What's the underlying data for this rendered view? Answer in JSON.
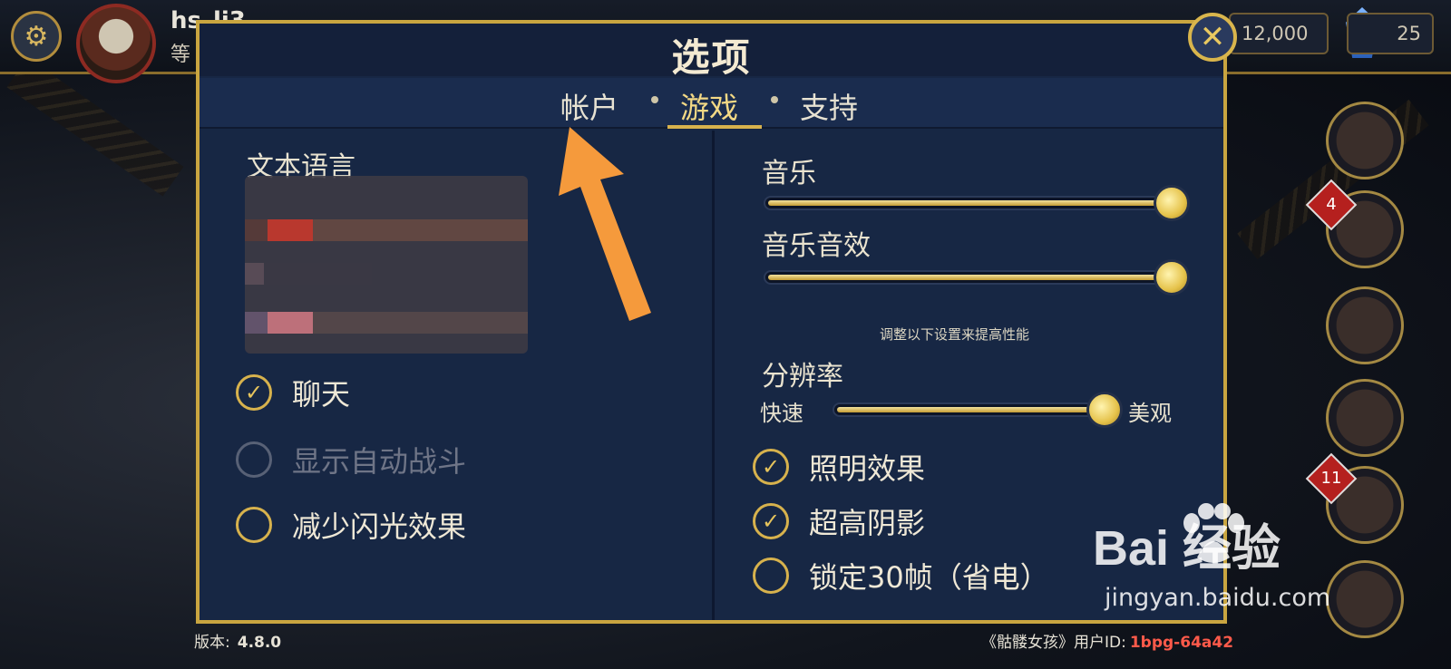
{
  "hud": {
    "username": "hs_li3",
    "level_prefix": "等",
    "coins": "12,000",
    "gems": "25"
  },
  "side_badges": [
    "4",
    "11"
  ],
  "dialog": {
    "title": "选项",
    "tabs": [
      {
        "label": "帐户",
        "active": false
      },
      {
        "label": "游戏",
        "active": true
      },
      {
        "label": "支持",
        "active": false
      }
    ],
    "left": {
      "language_title": "文本语言",
      "options": [
        {
          "label": "聊天",
          "checked": true,
          "enabled": true
        },
        {
          "label": "显示自动战斗",
          "checked": false,
          "enabled": false
        },
        {
          "label": "减少闪光效果",
          "checked": false,
          "enabled": true
        }
      ]
    },
    "right": {
      "music_label": "音乐",
      "music_level": 1.0,
      "sfx_label": "音乐音效",
      "sfx_level": 1.0,
      "perf_hint": "调整以下设置来提高性能",
      "resolution_label": "分辨率",
      "resolution_min": "快速",
      "resolution_max": "美观",
      "resolution_level": 1.0,
      "options": [
        {
          "label": "照明效果",
          "checked": true
        },
        {
          "label": "超高阴影",
          "checked": true
        },
        {
          "label": "锁定30帧（省电）",
          "checked": false
        }
      ]
    }
  },
  "footer": {
    "version_label": "版本:",
    "version": "4.8.0",
    "game_user_label": "《骷髅女孩》用户ID:",
    "user_id": "1bpg-64a42"
  },
  "watermark": {
    "logo": "Bai  经验",
    "url": "jingyan.baidu.com"
  },
  "colors": {
    "accent_gold": "#d7b24d",
    "dialog_bg": "#172744",
    "arrow": "#f59a3c",
    "user_id": "#ff5a4a"
  }
}
